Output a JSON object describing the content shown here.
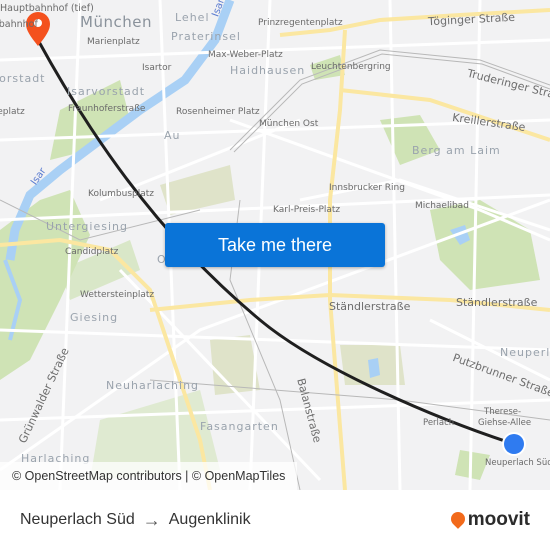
{
  "map": {
    "labels": {
      "hauptbahnhof_tief": "Hauptbahnhof (tief)",
      "hauptbahnhof": "Hauptbahnhof",
      "muenchen": "München",
      "lehel": "Lehel",
      "isar_top": "Isar",
      "prinzregentenplatz": "Prinzregentenplatz",
      "toeginger": "Töginger Straße",
      "marienplatz": "Marienplatz",
      "praterinsel": "Praterinsel",
      "max_weber_platz": "Max-Weber-Platz",
      "isartor": "Isartor",
      "haidhausen": "Haidhausen",
      "leuchtenbergring": "Leuchtenbergring",
      "truderinger": "Truderinger Straße",
      "vorstadt": "Ludwigsvorstadt",
      "isarvorstadt": "Isarvorstadt",
      "goetheplatz": "Goetheplatz",
      "fraunhoferstrasse": "Fraunhoferstraße",
      "rosenheimer_platz": "Rosenheimer Platz",
      "muenchen_ost": "München Ost",
      "kreillerstrasse": "Kreillerstraße",
      "au": "Au",
      "berg_am_laim": "Berg am Laim",
      "isar": "Isar",
      "kolumbusplatz": "Kolumbusplatz",
      "innsbrucker_ring": "Innsbrucker Ring",
      "karl_preis_platz": "Karl-Preis-Platz",
      "michaelibad": "Michaelibad",
      "untergiesing": "Untergiesing",
      "candidplatz": "Candidplatz",
      "obergiesing": "O",
      "wettersteinplatz": "Wettersteinplatz",
      "giesing": "Giesing",
      "staendlerstrasse_1": "Ständlerstraße",
      "staendlerstrasse_2": "Ständlerstraße",
      "neuperlach": "Neuperlach",
      "gruenwalder": "Grünwalder Straße",
      "neuharlaching": "Neuharlaching",
      "putzbrunner": "Putzbrunner Straße",
      "balanstrasse": "Balanstraße",
      "therese_giehse_allee_1": "Therese-",
      "therese_giehse_allee_2": "Giehse-Allee",
      "fasangarten": "Fasangarten",
      "perlach": "Perlach",
      "harlaching": "Harlaching",
      "neuperlach_sued": "Neuperlach Süd"
    },
    "markers": {
      "destination_icon": "map-pin-icon",
      "origin_icon": "origin-dot-icon"
    },
    "colors": {
      "destination_pin": "#f4511e",
      "origin_dot": "#2f7bf0",
      "route_line": "#1f1f1f",
      "cta": "#0a74d8"
    }
  },
  "cta": {
    "label": "Take me there"
  },
  "attribution": {
    "text": "© OpenStreetMap contributors | © OpenMapTiles"
  },
  "footer": {
    "origin": "Neuperlach Süd",
    "arrow": "→",
    "destination": "Augenklinik",
    "brand": "moovit"
  }
}
